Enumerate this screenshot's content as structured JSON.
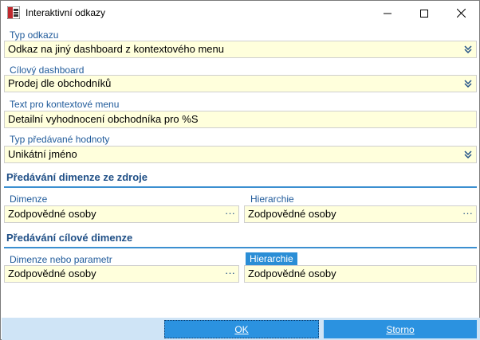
{
  "window": {
    "title": "Interaktivní odkazy"
  },
  "fields": {
    "typ_odkazu": {
      "label": "Typ odkazu",
      "value": "Odkaz na jiný dashboard z kontextového menu"
    },
    "cilovy_dashboard": {
      "label": "Cílový dashboard",
      "value": "Prodej dle obchodníků"
    },
    "text_menu": {
      "label": "Text pro kontextové menu",
      "value": "Detailní vyhodnocení obchodníka pro %S"
    },
    "typ_hodnoty": {
      "label": "Typ předávané hodnoty",
      "value": "Unikátní jméno"
    }
  },
  "section_source": {
    "title": "Předávání dimenze ze zdroje",
    "dimenze_label": "Dimenze",
    "dimenze_value": "Zodpovědné osoby",
    "hierarchie_label": "Hierarchie",
    "hierarchie_value": "Zodpovědné osoby"
  },
  "section_target": {
    "title": "Předávání cílové dimenze",
    "dimenze_label": "Dimenze nebo parametr",
    "dimenze_value": "Zodpovědné osoby",
    "hierarchie_label": "Hierarchie",
    "hierarchie_value": "Zodpovědné osoby"
  },
  "buttons": {
    "ok": "OK",
    "cancel": "Storno"
  },
  "ellipsis": "···",
  "icons": {
    "app": "app-logo-icon",
    "minimize": "minimize-icon",
    "maximize": "maximize-icon",
    "close": "close-icon",
    "dropdown": "double-chevron-down-icon"
  },
  "colors": {
    "label": "#1f5a9a",
    "field_bg": "#ffffdc",
    "accent": "#2b92e0",
    "bottom_bar": "#cfe4f6"
  }
}
